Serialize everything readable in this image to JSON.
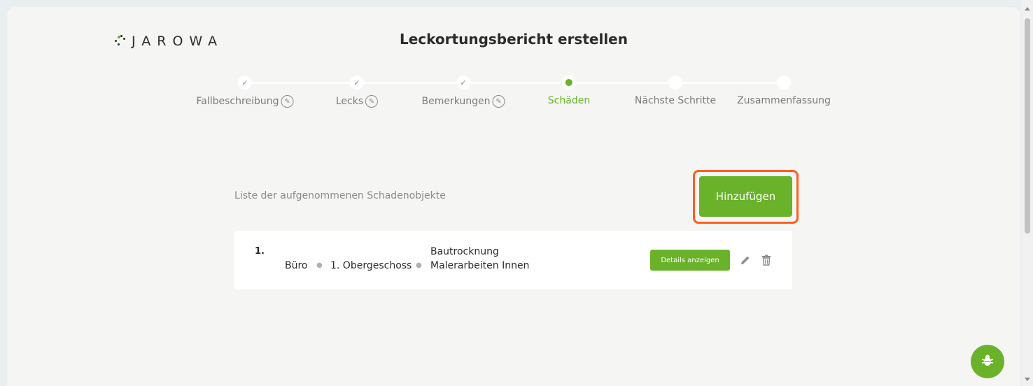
{
  "header": {
    "logo_text": "JAROWA",
    "title": "Leckortungsbericht erstellen"
  },
  "stepper": {
    "steps": [
      {
        "label": "Fallbeschreibung",
        "state": "done",
        "editable": true
      },
      {
        "label": "Lecks",
        "state": "done",
        "editable": true
      },
      {
        "label": "Bemerkungen",
        "state": "done",
        "editable": true
      },
      {
        "label": "Schäden",
        "state": "active",
        "editable": false
      },
      {
        "label": "Nächste Schritte",
        "state": "pending",
        "editable": false
      },
      {
        "label": "Zusammenfassung",
        "state": "pending",
        "editable": false
      }
    ]
  },
  "damage_list": {
    "label": "Liste der aufgenommenen Schadenobjekte",
    "add_label": "Hinzufügen",
    "items": [
      {
        "number": "1.",
        "room": "Büro",
        "floor": "1. Obergeschoss",
        "works": [
          "Bautrocknung",
          "Malerarbeiten Innen"
        ],
        "details_label": "Details anzeigen"
      }
    ]
  },
  "colors": {
    "accent": "#6ab22a",
    "highlight": "#ff5f1f",
    "background": "#f5f5f4"
  },
  "icons": {
    "edit": "pencil-icon",
    "delete": "trash-icon",
    "bug": "bug-icon",
    "check": "check-icon"
  }
}
